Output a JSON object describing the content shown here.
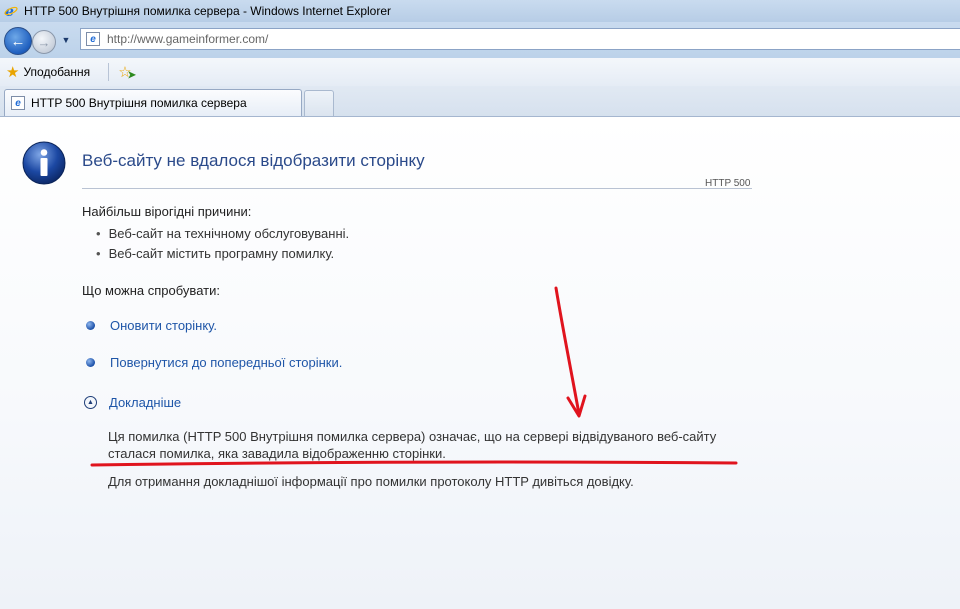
{
  "window": {
    "title": "HTTP 500 Внутрішня помилка сервера - Windows Internet Explorer"
  },
  "navigation": {
    "address": "http://www.gameinformer.com/"
  },
  "favorites_bar": {
    "favorites_label": "Уподобання"
  },
  "tabs": [
    {
      "label": "HTTP 500 Внутрішня помилка сервера"
    }
  ],
  "error_page": {
    "heading": "Веб-сайту не вдалося відобразити сторінку",
    "code": "HTTP 500",
    "causes_title": "Найбільш вірогідні причини:",
    "causes": [
      "Веб-сайт на технічному обслуговуванні.",
      "Веб-сайт містить програмну помилку."
    ],
    "try_title": "Що можна спробувати:",
    "actions": [
      {
        "label": "Оновити сторінку."
      },
      {
        "label": "Повернутися до попередньої сторінки."
      }
    ],
    "more_info_label": "Докладніше",
    "details_text": "Ця помилка (HTTP 500 Внутрішня помилка сервера) означає, що на сервері відвідуваного веб-сайту сталася помилка, яка завадила відображенню сторінки.",
    "help_text": "Для отримання докладнішої інформації про помилки протоколу HTTP дивіться довідку."
  },
  "annotation": {
    "color": "#e0141e"
  }
}
